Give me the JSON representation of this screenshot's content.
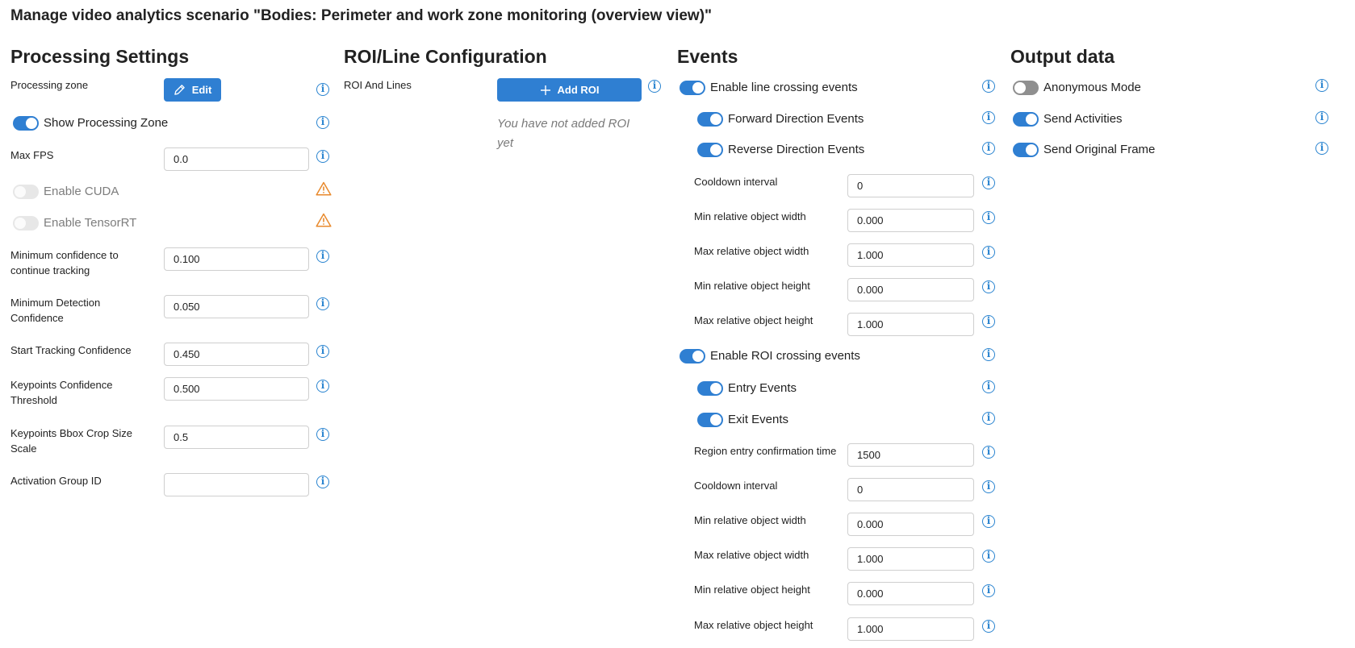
{
  "page": {
    "title": "Manage video analytics scenario \"Bodies: Perimeter and work zone monitoring (overview view)\""
  },
  "processing": {
    "title": "Processing Settings",
    "processing_zone_label": "Processing zone",
    "edit_label": "Edit",
    "show_zone_label": "Show Processing Zone",
    "max_fps_label": "Max FPS",
    "max_fps_value": "0.0",
    "cuda_label": "Enable CUDA",
    "tensorrt_label": "Enable TensorRT",
    "min_conf_label": "Minimum confidence to continue tracking",
    "min_conf_value": "0.100",
    "min_det_label": "Minimum Detection Confidence",
    "min_det_value": "0.050",
    "start_track_label": "Start Tracking Confidence",
    "start_track_value": "0.450",
    "kp_conf_label": "Keypoints Confidence Threshold",
    "kp_conf_value": "0.500",
    "kp_bbox_label": "Keypoints Bbox Crop Size Scale",
    "kp_bbox_value": "0.5",
    "group_label": "Activation Group ID",
    "group_value": ""
  },
  "roi": {
    "title": "ROI/Line Configuration",
    "label": "ROI And Lines",
    "add_label": "Add ROI",
    "empty_text": "You have not added ROI yet"
  },
  "events": {
    "title": "Events",
    "line_crossing_label": "Enable line crossing events",
    "forward_label": "Forward Direction Events",
    "reverse_label": "Reverse Direction Events",
    "line": {
      "cooldown_label": "Cooldown interval",
      "cooldown_value": "0",
      "min_w_label": "Min relative object width",
      "min_w_value": "0.000",
      "max_w_label": "Max relative object width",
      "max_w_value": "1.000",
      "min_h_label": "Min relative object height",
      "min_h_value": "0.000",
      "max_h_label": "Max relative object height",
      "max_h_value": "1.000"
    },
    "roi_crossing_label": "Enable ROI crossing events",
    "entry_label": "Entry Events",
    "exit_label": "Exit Events",
    "roi_params": {
      "entry_time_label": "Region entry confirmation time",
      "entry_time_value": "1500",
      "cooldown_label": "Cooldown interval",
      "cooldown_value": "0",
      "min_w_label": "Min relative object width",
      "min_w_value": "0.000",
      "max_w_label": "Max relative object width",
      "max_w_value": "1.000",
      "min_h_label": "Min relative object height",
      "min_h_value": "0.000",
      "max_h_label": "Max relative object height",
      "max_h_value": "1.000"
    }
  },
  "output": {
    "title": "Output data",
    "anonymous_label": "Anonymous Mode",
    "activities_label": "Send Activities",
    "frame_label": "Send Original Frame"
  },
  "colors": {
    "accent": "#2f7fd2",
    "info": "#2a84d0",
    "warning": "#e8892c",
    "toggle_off": "#8f8f8f"
  },
  "icons": {
    "info": "info-circle-icon",
    "warning": "warning-triangle-icon",
    "edit": "pencil-icon",
    "add": "plus-icon"
  }
}
